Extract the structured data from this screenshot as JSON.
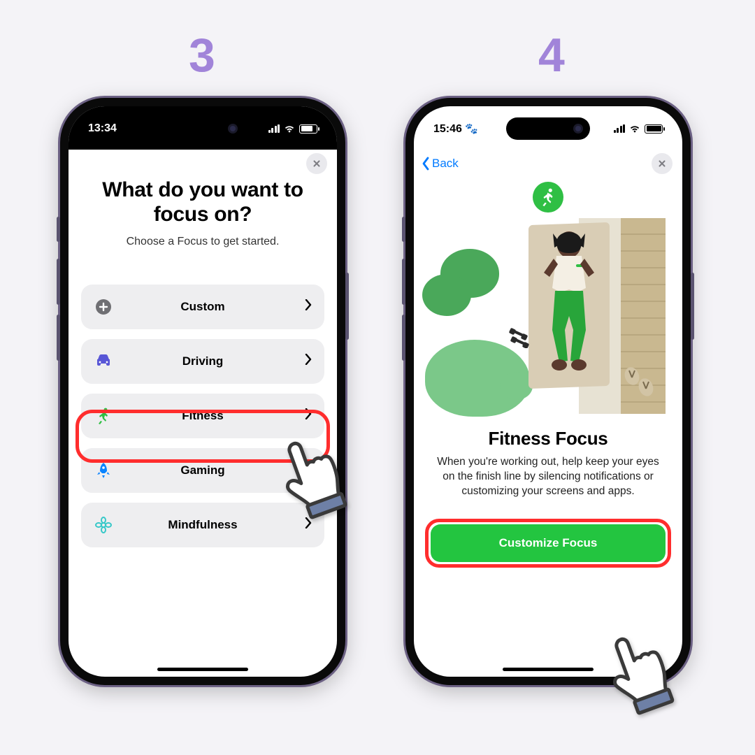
{
  "steps": {
    "a": "3",
    "b": "4"
  },
  "phone_a": {
    "status_time": "13:34",
    "title_line1": "What do you want to",
    "title_line2": "focus on?",
    "subtitle": "Choose a Focus to get started.",
    "items": [
      {
        "icon": "plus",
        "label": "Custom",
        "color": "#6f6f73"
      },
      {
        "icon": "car",
        "label": "Driving",
        "color": "#5856d6"
      },
      {
        "icon": "runner",
        "label": "Fitness",
        "color": "#2fbf44"
      },
      {
        "icon": "rocket",
        "label": "Gaming",
        "color": "#0a84ff"
      },
      {
        "icon": "lotus",
        "label": "Mindfulness",
        "color": "#36c8c8"
      }
    ],
    "highlighted_index": 2
  },
  "phone_b": {
    "status_time": "15:46",
    "back_label": "Back",
    "heading": "Fitness Focus",
    "description": "When you're working out, help keep your eyes on the finish line by silencing notifications or customizing your screens and apps.",
    "cta_label": "Customize Focus"
  }
}
